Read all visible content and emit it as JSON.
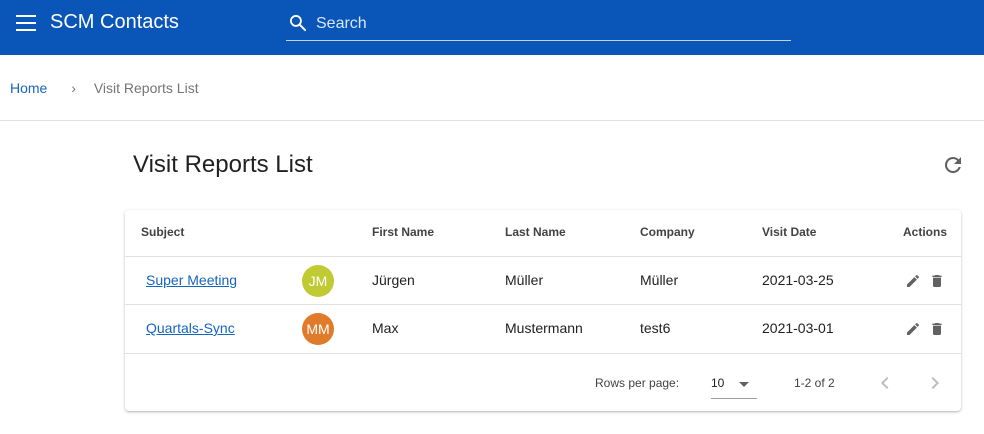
{
  "app": {
    "title": "SCM Contacts"
  },
  "search": {
    "placeholder": "Search"
  },
  "breadcrumb": {
    "home": "Home",
    "separator": "›",
    "current": "Visit Reports List"
  },
  "page": {
    "title": "Visit Reports List"
  },
  "table": {
    "headers": {
      "subject": "Subject",
      "first_name": "First Name",
      "last_name": "Last Name",
      "company": "Company",
      "visit_date": "Visit Date",
      "actions": "Actions"
    },
    "rows": [
      {
        "subject": "Super Meeting",
        "initials": "JM",
        "avatar_color": "#c0ca33",
        "first_name": "Jürgen",
        "last_name": "Müller",
        "company": "Müller",
        "visit_date": "2021-03-25"
      },
      {
        "subject": "Quartals-Sync",
        "initials": "MM",
        "avatar_color": "#e07b2a",
        "first_name": "Max",
        "last_name": "Mustermann",
        "company": "test6",
        "visit_date": "2021-03-01"
      }
    ],
    "actions": {
      "edit_icon": "pencil-icon",
      "delete_icon": "trash-icon"
    }
  },
  "pagination": {
    "rows_per_page_label": "Rows per page:",
    "rows_per_page": "10",
    "range": "1-2 of 2"
  },
  "colors": {
    "appbar": "#0a56b8",
    "link": "#1565c0"
  }
}
